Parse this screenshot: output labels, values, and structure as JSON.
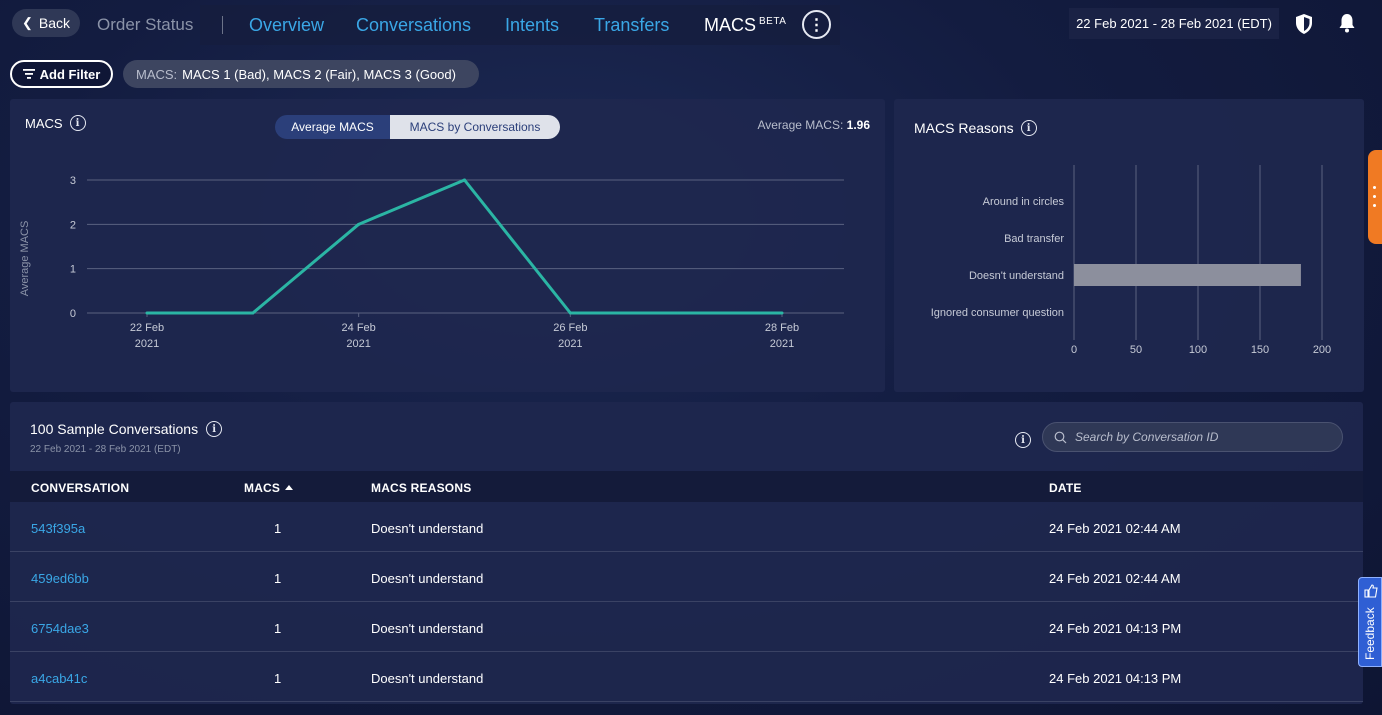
{
  "nav": {
    "back_label": "Back",
    "page_name": "Order Status",
    "tabs": [
      {
        "label": "Overview"
      },
      {
        "label": "Conversations"
      },
      {
        "label": "Intents"
      },
      {
        "label": "Transfers"
      },
      {
        "label": "MACS",
        "badge": "BETA"
      }
    ],
    "kebab": "⋮",
    "date_range": "22 Feb 2021 - 28 Feb 2021 (EDT)",
    "icons": [
      "shield-icon",
      "bell-icon"
    ]
  },
  "filters": {
    "add_label": "Add Filter",
    "chip_key": "MACS:",
    "chip_value": "MACS 1 (Bad), MACS 2 (Fair), MACS 3 (Good)"
  },
  "macs_panel": {
    "title": "MACS",
    "toggle": {
      "on": "Average MACS",
      "off": "MACS by Conversations"
    },
    "avg_label": "Average MACS:",
    "avg_value": "1.96"
  },
  "reasons_panel": {
    "title": "MACS Reasons"
  },
  "chart_data": [
    {
      "type": "line",
      "ylabel": "Average MACS",
      "xlabel": "",
      "ylim": [
        0,
        3
      ],
      "yticks": [
        "0",
        "1",
        "2",
        "3"
      ],
      "xticks": [
        {
          "line1": "22 Feb",
          "line2": "2021"
        },
        {
          "line1": "24 Feb",
          "line2": "2021"
        },
        {
          "line1": "26 Feb",
          "line2": "2021"
        },
        {
          "line1": "28 Feb",
          "line2": "2021"
        }
      ],
      "x": [
        "2021-02-22",
        "2021-02-23",
        "2021-02-24",
        "2021-02-25",
        "2021-02-26",
        "2021-02-27",
        "2021-02-28"
      ],
      "series": [
        {
          "values": [
            0,
            0,
            2,
            3,
            0,
            0,
            0
          ],
          "color": "#2bb5a4"
        }
      ],
      "grid": true
    },
    {
      "type": "bar",
      "orientation": "horizontal",
      "categories": [
        "Around in circles",
        "Bad transfer",
        "Doesn't understand",
        "Ignored consumer question"
      ],
      "values": [
        0,
        0,
        183,
        0
      ],
      "xlim": [
        0,
        200
      ],
      "xticks": [
        "0",
        "50",
        "100",
        "150",
        "200"
      ],
      "bar_color": "#8c8f9d",
      "grid": true
    }
  ],
  "table": {
    "title": "100 Sample Conversations",
    "subtitle": "22 Feb 2021 - 28 Feb 2021 (EDT)",
    "search_placeholder": "Search by Conversation ID",
    "columns": [
      "CONVERSATION",
      "MACS",
      "MACS REASONS",
      "DATE"
    ],
    "rows": [
      {
        "id": "543f395a",
        "macs": "1",
        "reason": "Doesn't understand",
        "date": "24 Feb 2021 02:44 AM"
      },
      {
        "id": "459ed6bb",
        "macs": "1",
        "reason": "Doesn't understand",
        "date": "24 Feb 2021 02:44 AM"
      },
      {
        "id": "6754dae3",
        "macs": "1",
        "reason": "Doesn't understand",
        "date": "24 Feb 2021 04:13 PM"
      },
      {
        "id": "a4cab41c",
        "macs": "1",
        "reason": "Doesn't understand",
        "date": "24 Feb 2021 04:13 PM"
      }
    ]
  },
  "side": {
    "feedback_label": "Feedback"
  }
}
